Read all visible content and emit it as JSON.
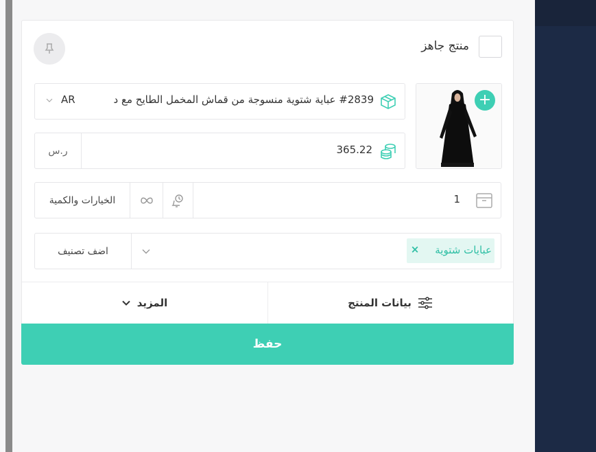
{
  "product": {
    "ready_label": "منتج جاهز",
    "name": "#2839 عباية شتوية منسوجة من قماش المخمل الطايح مع د",
    "language": "AR",
    "price": "365.22",
    "currency": "ر.س",
    "quantity": "1",
    "options_label": "الخيارات والكمية",
    "category_tag": "عبايات شتوية",
    "add_category_label": "اضف تصنيف"
  },
  "tabs": {
    "more_label": "المزيد",
    "data_label": "بيانات المنتج"
  },
  "save_label": "حفظ",
  "colors": {
    "accent": "#3ecfb4",
    "tag_bg": "#e3f7f2",
    "sidebar": "#1c2a45"
  },
  "icons": [
    "pin-icon",
    "box-icon",
    "coins-icon",
    "archive-icon",
    "alarm-icon",
    "infinity-icon",
    "chevron-down-icon",
    "close-icon",
    "plus-icon",
    "sliders-icon"
  ]
}
